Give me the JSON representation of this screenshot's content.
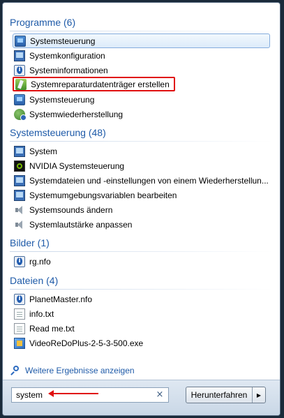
{
  "sections": [
    {
      "title": "Programme (6)",
      "items": [
        {
          "label": "Systemsteuerung",
          "icon": "control-panel-icon"
        },
        {
          "label": "Systemkonfiguration",
          "icon": "system-config-icon"
        },
        {
          "label": "Systeminformationen",
          "icon": "system-info-icon"
        },
        {
          "label": "Systemreparaturdatenträger erstellen",
          "icon": "repair-disc-icon"
        },
        {
          "label": "Systemsteuerung",
          "icon": "control-panel-icon"
        },
        {
          "label": "Systemwiederherstellung",
          "icon": "system-restore-icon"
        }
      ]
    },
    {
      "title": "Systemsteuerung (48)",
      "items": [
        {
          "label": "System",
          "icon": "system-monitor-icon"
        },
        {
          "label": "NVIDIA Systemsteuerung",
          "icon": "nvidia-icon"
        },
        {
          "label": "Systemdateien und -einstellungen von einem Wiederherstellun...",
          "icon": "system-monitor-icon"
        },
        {
          "label": "Systemumgebungsvariablen bearbeiten",
          "icon": "system-monitor-icon"
        },
        {
          "label": "Systemsounds ändern",
          "icon": "speaker-icon"
        },
        {
          "label": "Systemlautstärke anpassen",
          "icon": "speaker-icon"
        }
      ]
    },
    {
      "title": "Bilder (1)",
      "items": [
        {
          "label": "rg.nfo",
          "icon": "nfo-file-icon"
        }
      ]
    },
    {
      "title": "Dateien (4)",
      "items": [
        {
          "label": "PlanetMaster.nfo",
          "icon": "nfo-file-icon"
        },
        {
          "label": "info.txt",
          "icon": "text-file-icon"
        },
        {
          "label": "Read me.txt",
          "icon": "text-file-icon"
        },
        {
          "label": "VideoReDoPlus-2-5-3-500.exe",
          "icon": "exe-file-icon"
        }
      ]
    }
  ],
  "more_results": "Weitere Ergebnisse anzeigen",
  "search": {
    "value": "system",
    "clear_icon": "×"
  },
  "shutdown": {
    "label": "Herunterfahren",
    "arrow": "▶"
  },
  "colors": {
    "accent": "#1e5aa8",
    "highlight": "#e01010",
    "selection_border": "#84acdd"
  }
}
